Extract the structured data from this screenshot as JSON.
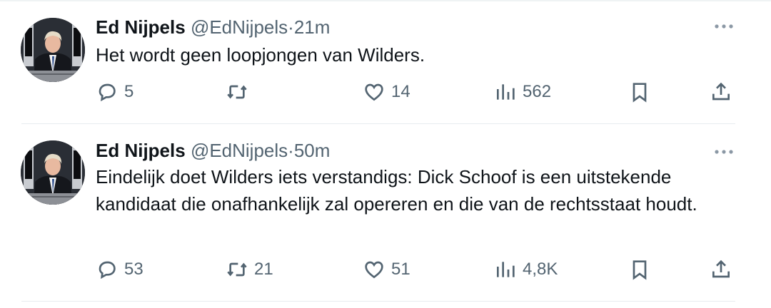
{
  "tweets": [
    {
      "author_name": "Ed Nijpels",
      "handle": "@EdNijpels",
      "separator": "·",
      "time": "21m",
      "text": "Het wordt geen loopjongen van Wilders.",
      "replies": "5",
      "retweets": "",
      "likes": "14",
      "views": "562"
    },
    {
      "author_name": "Ed Nijpels",
      "handle": "@EdNijpels",
      "separator": "·",
      "time": "50m",
      "text": "Eindelijk doet Wilders iets verstandigs: Dick Schoof is een uitstekende kandidaat  die onafhankelijk zal opereren en die van de rechtsstaat houdt.",
      "replies": "53",
      "retweets": "21",
      "likes": "51",
      "views": "4,8K"
    }
  ],
  "icons": {
    "more": "more-horizontal-icon",
    "reply": "reply-bubble-icon",
    "retweet": "retweet-icon",
    "like": "heart-icon",
    "views": "views-bar-chart-icon",
    "bookmark": "bookmark-icon",
    "share": "share-upload-icon"
  },
  "colors": {
    "text_primary": "#0f1419",
    "text_secondary": "#536471",
    "divider": "#e7ecef",
    "background": "#ffffff"
  }
}
